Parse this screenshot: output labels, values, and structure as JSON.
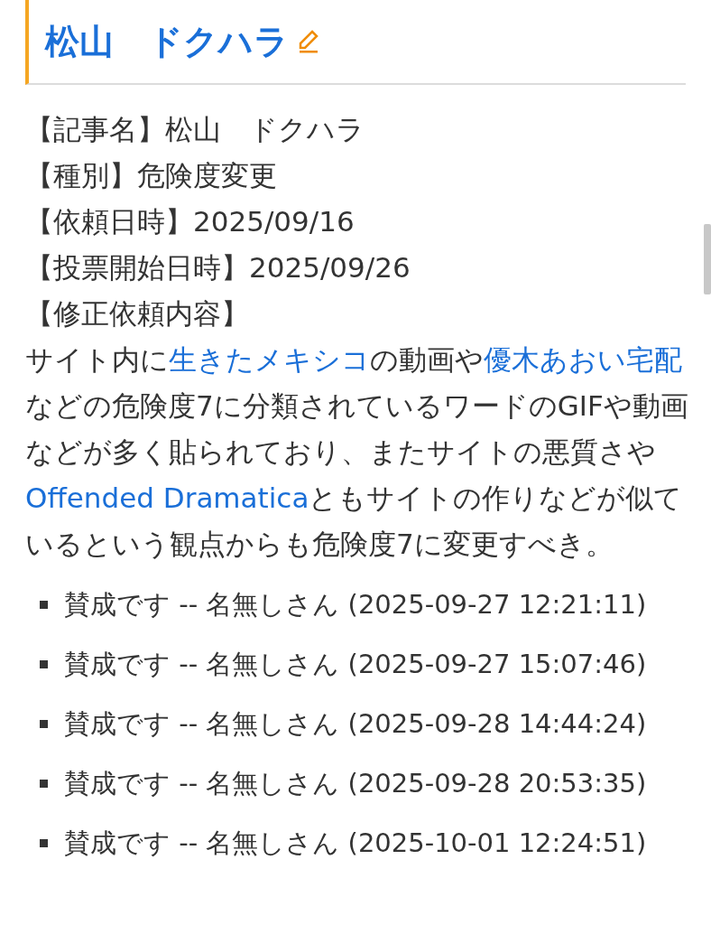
{
  "title": "松山　ドクハラ",
  "fields": [
    "【記事名】松山　ドクハラ",
    "【種別】危険度変更",
    "【依頼日時】2025/09/16",
    "【投票開始日時】2025/09/26",
    "【修正依頼内容】"
  ],
  "paragraph": [
    {
      "kind": "text",
      "text": "サイト内に"
    },
    {
      "kind": "link",
      "text": "生きたメキシコ"
    },
    {
      "kind": "text",
      "text": "の動画や"
    },
    {
      "kind": "link",
      "text": "優木あおい宅配"
    },
    {
      "kind": "text",
      "text": "などの危険度7に分類されているワードのGIFや動画などが多く貼られており、またサイトの悪質さや"
    },
    {
      "kind": "link",
      "text": "Offended Dramatica"
    },
    {
      "kind": "text",
      "text": "ともサイトの作りなどが似ているという観点からも危険度7に変更すべき。"
    }
  ],
  "comments": [
    "賛成です -- 名無しさん (2025-09-27 12:21:11)",
    "賛成です -- 名無しさん (2025-09-27 15:07:46)",
    "賛成です -- 名無しさん (2025-09-28 14:44:24)",
    "賛成です -- 名無しさん (2025-09-28 20:53:35)",
    "賛成です -- 名無しさん (2025-10-01 12:24:51)"
  ]
}
